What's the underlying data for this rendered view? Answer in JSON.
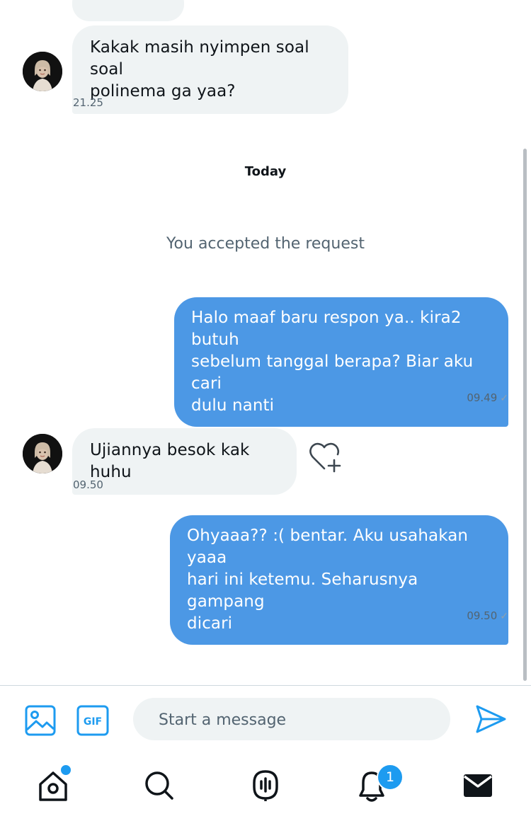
{
  "thread": {
    "messages": [
      {
        "id": "m1",
        "direction": "incoming",
        "lines": [
          "Kakak masih nyimpen soal soal",
          "polinema ga yaa?"
        ],
        "time": "21.25"
      },
      {
        "id": "m2",
        "direction": "outgoing",
        "lines": [
          "Halo maaf baru respon ya.. kira2 butuh",
          "sebelum tanggal berapa? Biar aku cari",
          "dulu nanti"
        ],
        "time": "09.49",
        "status": "✓"
      },
      {
        "id": "m3",
        "direction": "incoming",
        "lines": [
          "Ujiannya besok kak huhu"
        ],
        "time": "09.50"
      },
      {
        "id": "m4",
        "direction": "outgoing",
        "lines": [
          "Ohyaaa?? :( bentar. Aku usahakan yaaa",
          "hari ini ketemu. Seharusnya gampang",
          "dicari"
        ],
        "time": "09.50",
        "status": "✓"
      }
    ],
    "day_separator": "Today",
    "system_message": "You accepted the request"
  },
  "composer": {
    "placeholder": "Start a message",
    "value": "",
    "icons": [
      "image-icon",
      "gif-icon",
      "send-icon"
    ],
    "gif_label": "GIF"
  },
  "tabbar": {
    "tabs": [
      "home-icon",
      "search-icon",
      "spaces-icon",
      "notifications-icon",
      "messages-icon"
    ],
    "notifications_badge": "1"
  },
  "colors": {
    "accent": "#1d9bf0",
    "outgoing_bubble": "#4c98e5",
    "incoming_bubble": "#eff3f4",
    "muted_text": "#536471"
  }
}
